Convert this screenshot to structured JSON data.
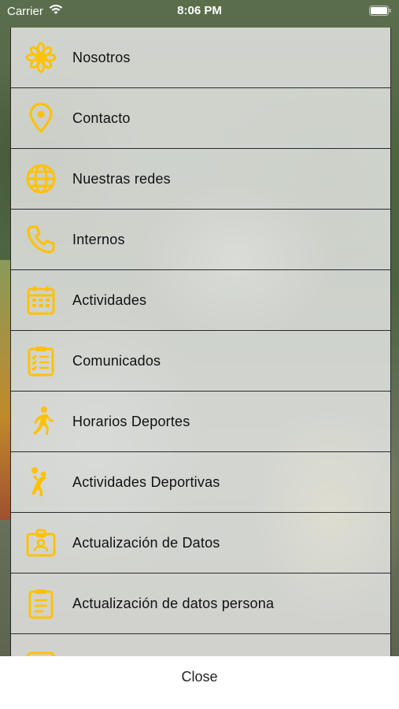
{
  "status_bar": {
    "carrier": "Carrier",
    "time": "8:06 PM",
    "wifi_icon": "wifi-icon",
    "battery_icon": "battery-full-icon"
  },
  "theme": {
    "accent": "#FFC107",
    "panel_background": "#EEEEEE",
    "divider": "#2A2A2A",
    "text": "#111111"
  },
  "menu": {
    "items": [
      {
        "label": "Nosotros",
        "icon": "flower-icon"
      },
      {
        "label": "Contacto",
        "icon": "map-pin-icon"
      },
      {
        "label": "Nuestras redes",
        "icon": "globe-icon"
      },
      {
        "label": "Internos",
        "icon": "phone-icon"
      },
      {
        "label": "Actividades",
        "icon": "calendar-icon"
      },
      {
        "label": "Comunicados",
        "icon": "clipboard-checklist-icon"
      },
      {
        "label": "Horarios Deportes",
        "icon": "running-person-icon"
      },
      {
        "label": "Actividades Deportivas",
        "icon": "volleyball-player-icon"
      },
      {
        "label": "Actualización de Datos",
        "icon": "id-card-icon"
      },
      {
        "label": "Actualización de datos persona",
        "icon": "clipboard-list-icon"
      },
      {
        "label": "",
        "icon": "document-icon"
      }
    ]
  },
  "close_button": {
    "label": "Close"
  }
}
